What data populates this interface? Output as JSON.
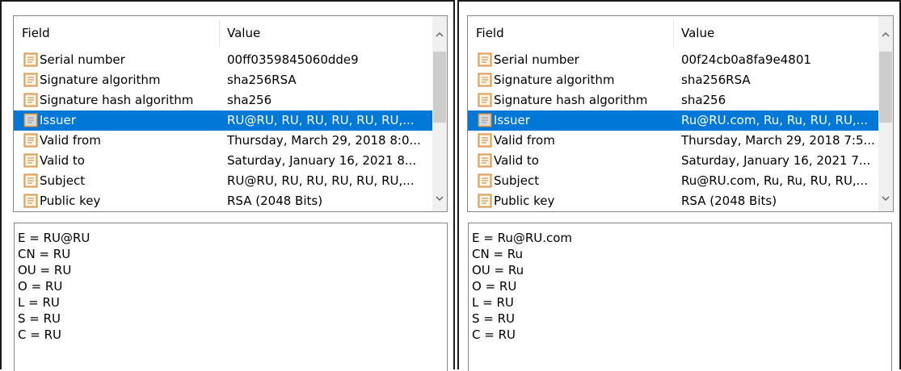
{
  "left": {
    "columns": {
      "field": "Field",
      "value": "Value"
    },
    "rows": [
      {
        "field": "Serial number",
        "value": "00ff0359845060dde9"
      },
      {
        "field": "Signature algorithm",
        "value": "sha256RSA"
      },
      {
        "field": "Signature hash algorithm",
        "value": "sha256"
      },
      {
        "field": "Issuer",
        "value": "RU@RU, RU, RU, RU, RU, RU,..."
      },
      {
        "field": "Valid from",
        "value": "Thursday, March 29, 2018 8:0..."
      },
      {
        "field": "Valid to",
        "value": "Saturday, January 16, 2021 8..."
      },
      {
        "field": "Subject",
        "value": "RU@RU, RU, RU, RU, RU, RU,..."
      },
      {
        "field": "Public key",
        "value": "RSA (2048 Bits)"
      }
    ],
    "selected_index": 3,
    "detail_lines": [
      "E = RU@RU",
      "CN = RU",
      "OU = RU",
      "O = RU",
      "L = RU",
      "S = RU",
      "C = RU"
    ]
  },
  "right": {
    "columns": {
      "field": "Field",
      "value": "Value"
    },
    "rows": [
      {
        "field": "Serial number",
        "value": "00f24cb0a8fa9e4801"
      },
      {
        "field": "Signature algorithm",
        "value": "sha256RSA"
      },
      {
        "field": "Signature hash algorithm",
        "value": "sha256"
      },
      {
        "field": "Issuer",
        "value": "Ru@RU.com, Ru, Ru, RU, RU,..."
      },
      {
        "field": "Valid from",
        "value": "Thursday, March 29, 2018 7:5..."
      },
      {
        "field": "Valid to",
        "value": "Saturday, January 16, 2021 7..."
      },
      {
        "field": "Subject",
        "value": "Ru@RU.com, Ru, Ru, RU, RU,..."
      },
      {
        "field": "Public key",
        "value": "RSA (2048 Bits)"
      }
    ],
    "selected_index": 3,
    "detail_lines": [
      "E = Ru@RU.com",
      "CN = Ru",
      "OU = Ru",
      "O = RU",
      "L = RU",
      "S = RU",
      "C = RU"
    ]
  },
  "icons": {
    "row": "certificate-field-icon",
    "scroll_up": "chevron-up-icon",
    "scroll_down": "chevron-down-icon"
  },
  "colors": {
    "selection": "#0078d7",
    "border": "#828790",
    "scrollbar_track": "#f0f0f0",
    "scrollbar_thumb": "#cdcdcd"
  }
}
